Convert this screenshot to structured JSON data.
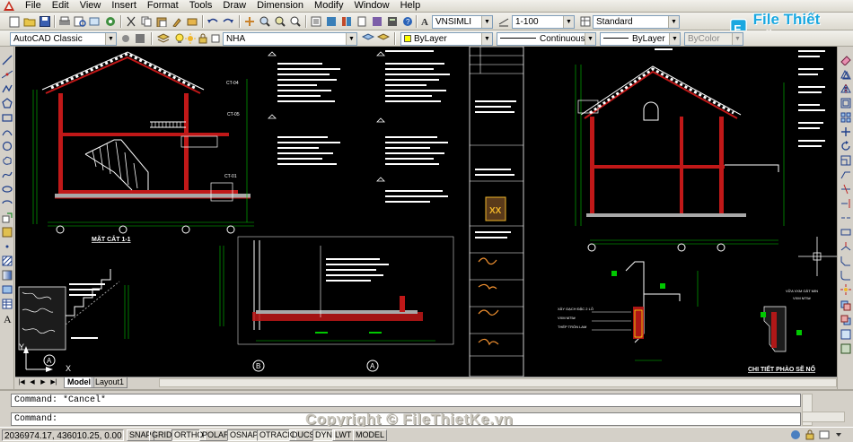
{
  "menu": [
    "File",
    "Edit",
    "View",
    "Insert",
    "Format",
    "Tools",
    "Draw",
    "Dimension",
    "Modify",
    "Window",
    "Help"
  ],
  "toolbar": {
    "text_style": "VNSIMLI",
    "dim_scale": "1-100",
    "dim_style": "Standard",
    "workspace": "AutoCAD Classic",
    "layer": "NHA",
    "color": "ByLayer",
    "linetype": "Continuous",
    "lineweight": "ByLayer",
    "plot_style": "ByColor"
  },
  "brand": {
    "name": "File Thiết Kế.vn"
  },
  "drawing": {
    "title_main_section": "MẶT CẮT 1-1",
    "title_detail": "CHI TIẾT PHÀO SẼ NỔ",
    "title_block_text": "XX",
    "label_ct04": "CT-04",
    "label_ct05": "CT-05",
    "label_ct01": "CT-01",
    "grid_b": "B",
    "grid_a": "A",
    "axis_x": "X",
    "axis_y": "Y",
    "note_lines": [
      "XÂY GẠCH ĐẶC 2 LỖ",
      "VXM M75#",
      "THÉP TRÒN LAM"
    ],
    "detail_notes": [
      "VXM M75#",
      "VỮA VXM GẮT MIN"
    ]
  },
  "layout_tabs": [
    "Model",
    "Layout1"
  ],
  "command": {
    "history": "Command: *Cancel*",
    "prompt": "Command:"
  },
  "copyright": "Copyright © FileThietKe.vn",
  "status": {
    "coords": "2036974.17, 436010.25, 0.00",
    "buttons": [
      "SNAP",
      "GRID",
      "ORTHO",
      "POLAR",
      "OSNAP",
      "OTRACK",
      "DUCS",
      "DYN",
      "LWT",
      "MODEL"
    ]
  },
  "colors": {
    "canvas": "#000000",
    "wall": "#c01818",
    "dim": "#00c800",
    "text": "#ffffff",
    "accent": "#ffff00",
    "cyan": "#00c8c8"
  }
}
